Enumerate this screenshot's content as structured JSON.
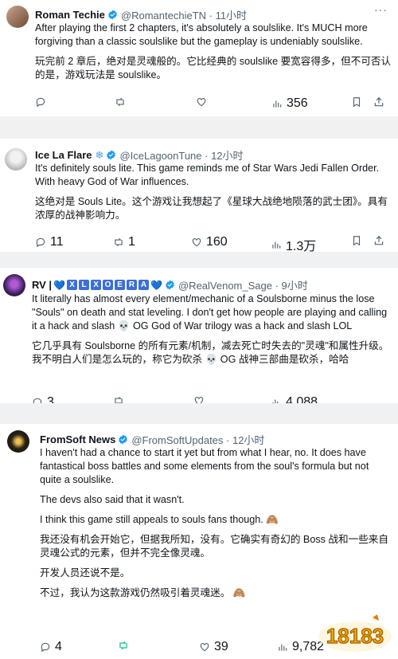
{
  "tweets": [
    {
      "name": "Roman Techie",
      "handle": "@RomantechieTN · 11小时",
      "body": [
        "After playing the first 2 chapters, it's absolutely a soulslike. It's MUCH more forgiving than a classic soulslike but the gameplay is undeniably soulslike.",
        "玩完前 2 章后，绝对是灵魂般的。它比经典的 soulslike 要宽容得多，但不可否认的是，游戏玩法是 soulslike。"
      ],
      "replies": "",
      "retweets": "",
      "likes": "",
      "views": "356"
    },
    {
      "name": "Ice La Flare",
      "handle": "@IceLagoonTune · 12小时",
      "body": [
        "It's definitely souls lite. This game reminds me of Star Wars Jedi Fallen Order. With heavy God of War influences.",
        "这绝对是 Souls Lite。这个游戏让我想起了《星球大战绝地陨落的武士团》。具有浓厚的战神影响力。"
      ],
      "replies": "11",
      "retweets": "1",
      "likes": "160",
      "views": "1.3万"
    },
    {
      "name": "RV |",
      "tags": [
        "X",
        "L",
        "X",
        "O",
        "E",
        "R",
        "A"
      ],
      "handle": "@RealVenom_Sage · 9小时",
      "body": [
        "It literally has almost every element/mechanic of a Soulsborne minus the lose \"Souls\" on death and stat leveling. I don't get how people are playing and calling it a hack and slash 💀 OG God of War trilogy was a hack and slash LOL",
        "它几乎具有 Soulsborne 的所有元素/机制，减去死亡时失去的\"灵魂\"和属性升级。我不明白人们是怎么玩的，称它为砍杀 💀 OG 战神三部曲是砍杀，哈哈"
      ],
      "replies": "3",
      "retweets": "",
      "likes": "",
      "views": "4,088"
    },
    {
      "name": "FromSoft News",
      "handle": "@FromSoftUpdates · 12小时",
      "body": [
        "I haven't had a chance to start it yet but from what I hear, no. It does have fantastical boss battles and some elements from the soul's formula but not quite a soulslike.",
        "The devs also said that it wasn't.",
        "I think this game still appeals to souls fans though. 🙈",
        "我还没有机会开始它，但据我所知，没有。它确实有奇幻的 Boss 战和一些来自灵魂公式的元素，但并不完全像灵魂。",
        "开发人员还说不是。",
        "不过，我认为这款游戏仍然吸引着灵魂迷。 🙈"
      ],
      "replies": "4",
      "retweets": "",
      "likes": "39",
      "views": "9,782"
    }
  ],
  "watermark": "18183",
  "colors": {
    "verified": "#1d9bf0",
    "muted": "#536471",
    "gap": "#eff1f3"
  }
}
